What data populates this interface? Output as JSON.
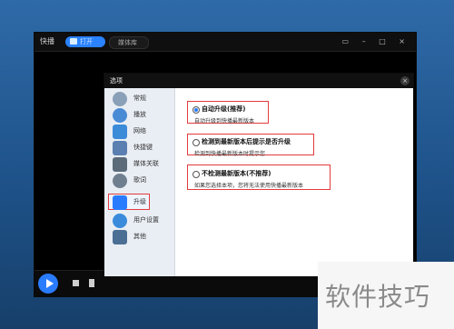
{
  "app": {
    "name": "快播",
    "tabs": [
      {
        "label": "打开",
        "active": true
      },
      {
        "label": "媒体库",
        "active": false
      }
    ],
    "window_controls": "▭ – □ ×"
  },
  "dialog": {
    "title": "选项",
    "close_symbol": "×",
    "sidebar": [
      {
        "label": "常规",
        "icon": "gear-icon",
        "color": "#8aa0b8"
      },
      {
        "label": "播放",
        "icon": "play-icon",
        "color": "#4a8bd6"
      },
      {
        "label": "网络",
        "icon": "network-icon",
        "color": "#3c8bd9"
      },
      {
        "label": "快捷键",
        "icon": "keyboard-icon",
        "color": "#5a7fb0"
      },
      {
        "label": "媒体关联",
        "icon": "media-link-icon",
        "color": "#5c6b7a"
      },
      {
        "label": "歌词",
        "icon": "lyrics-icon",
        "color": "#6f7f90"
      },
      {
        "label": "升级",
        "icon": "upgrade-icon",
        "color": "#2a7cff",
        "selected": true
      },
      {
        "label": "用户设置",
        "icon": "user-icon",
        "color": "#3a8bdc"
      },
      {
        "label": "其他",
        "icon": "other-icon",
        "color": "#4b6e95"
      }
    ],
    "options": [
      {
        "title": "自动升级(推荐)",
        "desc": "自动升级到快播最新版本",
        "checked": true
      },
      {
        "title": "检测到最新版本后提示是否升级",
        "desc": "检测到快播最新版本时提示您",
        "checked": false
      },
      {
        "title": "不检测最新版本(不推荐)",
        "desc": "如果您选择本项，您将无法使用快播最新版本",
        "checked": false
      }
    ]
  },
  "watermark": "软件技巧",
  "colors": {
    "accent": "#2a7cff",
    "highlight": "#e23b3b"
  }
}
